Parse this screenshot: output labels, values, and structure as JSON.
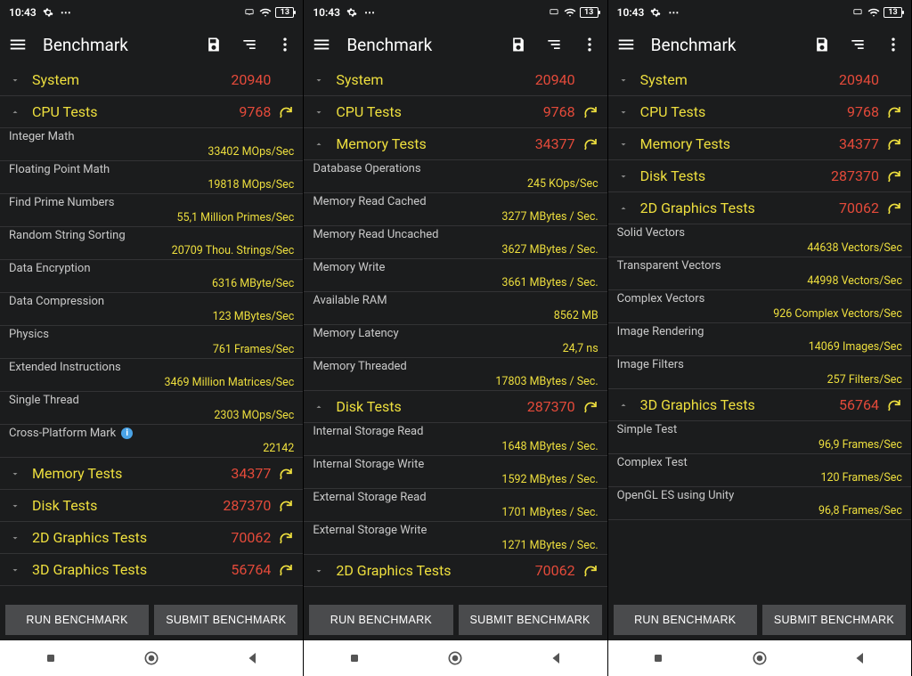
{
  "status": {
    "time": "10:43",
    "battery": "13"
  },
  "appbar": {
    "title": "Benchmark"
  },
  "buttons": {
    "run": "RUN BENCHMARK",
    "submit": "SUBMIT BENCHMARK"
  },
  "cat": {
    "system": {
      "label": "System",
      "score": "20940"
    },
    "cpu": {
      "label": "CPU Tests",
      "score": "9768"
    },
    "memory": {
      "label": "Memory Tests",
      "score": "34377"
    },
    "disk": {
      "label": "Disk Tests",
      "score": "287370"
    },
    "g2d": {
      "label": "2D Graphics Tests",
      "score": "70062"
    },
    "g3d": {
      "label": "3D Graphics Tests",
      "score": "56764"
    }
  },
  "cpu": {
    "int": {
      "l": "Integer Math",
      "v": "33402 MOps/Sec"
    },
    "float": {
      "l": "Floating Point Math",
      "v": "19818 MOps/Sec"
    },
    "prime": {
      "l": "Find Prime Numbers",
      "v": "55,1 Million Primes/Sec"
    },
    "sort": {
      "l": "Random String Sorting",
      "v": "20709 Thou. Strings/Sec"
    },
    "enc": {
      "l": "Data Encryption",
      "v": "6316 MByte/Sec"
    },
    "comp": {
      "l": "Data Compression",
      "v": "123 MBytes/Sec"
    },
    "phys": {
      "l": "Physics",
      "v": "761 Frames/Sec"
    },
    "ext": {
      "l": "Extended Instructions",
      "v": "3469 Million Matrices/Sec"
    },
    "single": {
      "l": "Single Thread",
      "v": "2303 MOps/Sec"
    },
    "cross": {
      "l": "Cross-Platform Mark",
      "v": "22142"
    }
  },
  "mem": {
    "db": {
      "l": "Database Operations",
      "v": "245 KOps/Sec"
    },
    "rcache": {
      "l": "Memory Read Cached",
      "v": "3277 MBytes / Sec."
    },
    "runc": {
      "l": "Memory Read Uncached",
      "v": "3627 MBytes / Sec."
    },
    "write": {
      "l": "Memory Write",
      "v": "3661 MBytes / Sec."
    },
    "ram": {
      "l": "Available RAM",
      "v": "8562 MB"
    },
    "lat": {
      "l": "Memory Latency",
      "v": "24,7 ns"
    },
    "thr": {
      "l": "Memory Threaded",
      "v": "17803 MBytes / Sec."
    }
  },
  "disk": {
    "iread": {
      "l": "Internal Storage Read",
      "v": "1648 MBytes / Sec."
    },
    "iwrite": {
      "l": "Internal Storage Write",
      "v": "1592 MBytes / Sec."
    },
    "eread": {
      "l": "External Storage Read",
      "v": "1701 MBytes / Sec."
    },
    "ewrite": {
      "l": "External Storage Write",
      "v": "1271 MBytes / Sec."
    }
  },
  "g2d": {
    "solid": {
      "l": "Solid Vectors",
      "v": "44638 Vectors/Sec"
    },
    "trans": {
      "l": "Transparent Vectors",
      "v": "44998 Vectors/Sec"
    },
    "comp": {
      "l": "Complex Vectors",
      "v": "926 Complex Vectors/Sec"
    },
    "img": {
      "l": "Image Rendering",
      "v": "14069 Images/Sec"
    },
    "filt": {
      "l": "Image Filters",
      "v": "257 Filters/Sec"
    }
  },
  "g3d": {
    "simple": {
      "l": "Simple Test",
      "v": "96,9 Frames/Sec"
    },
    "comp": {
      "l": "Complex Test",
      "v": "120 Frames/Sec"
    },
    "unity": {
      "l": "OpenGL ES using Unity",
      "v": "96,8 Frames/Sec"
    }
  }
}
